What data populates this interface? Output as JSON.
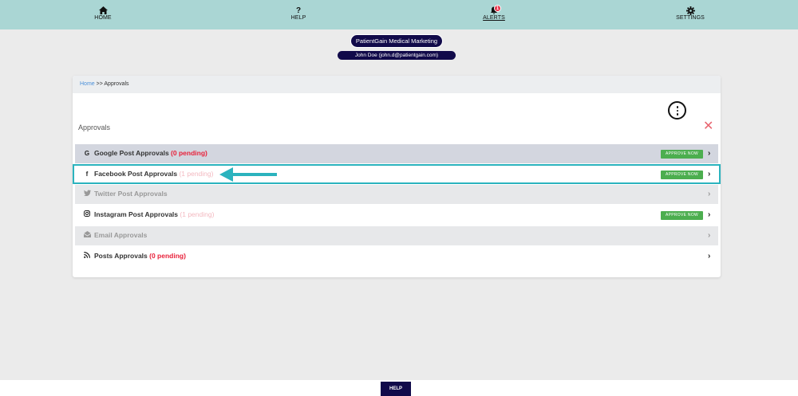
{
  "nav": {
    "items": [
      {
        "label": "HOME",
        "icon": "home-icon"
      },
      {
        "label": "HELP",
        "icon": "question-icon"
      },
      {
        "label": "ALERTS",
        "icon": "bell-icon",
        "badge": "1"
      },
      {
        "label": "SETTINGS",
        "icon": "gear-icon"
      }
    ]
  },
  "header": {
    "company": "PatientGain Medical Marketing",
    "user": "John Doe (john.d@patientgain.com)"
  },
  "breadcrumb": {
    "home": "Home",
    "separator": ">>",
    "current": "Approvals"
  },
  "section": {
    "title": "Approvals"
  },
  "rows": [
    {
      "label": "Google Post Approvals",
      "pending": "(0 pending)",
      "icon": "google-icon",
      "approve": "APPROVE NOW"
    },
    {
      "label": "Facebook Post Approvals",
      "pending": "(1 pending)",
      "icon": "facebook-icon",
      "approve": "APPROVE NOW"
    },
    {
      "label": "Twitter Post Approvals",
      "icon": "twitter-icon"
    },
    {
      "label": "Instagram Post Approvals",
      "pending": "(1 pending)",
      "icon": "instagram-icon",
      "approve": "APPROVE NOW"
    },
    {
      "label": "Email Approvals",
      "icon": "email-icon"
    },
    {
      "label": "Posts Approvals",
      "pending": "(0 pending)",
      "icon": "rss-icon"
    }
  ],
  "footer": {
    "help": "HELP"
  },
  "colors": {
    "nav_bg": "#aad6d4",
    "brand_dark": "#110a4a",
    "approve_green": "#4cae4f",
    "highlight": "#2bb3be",
    "pending_red": "#e8213a"
  }
}
